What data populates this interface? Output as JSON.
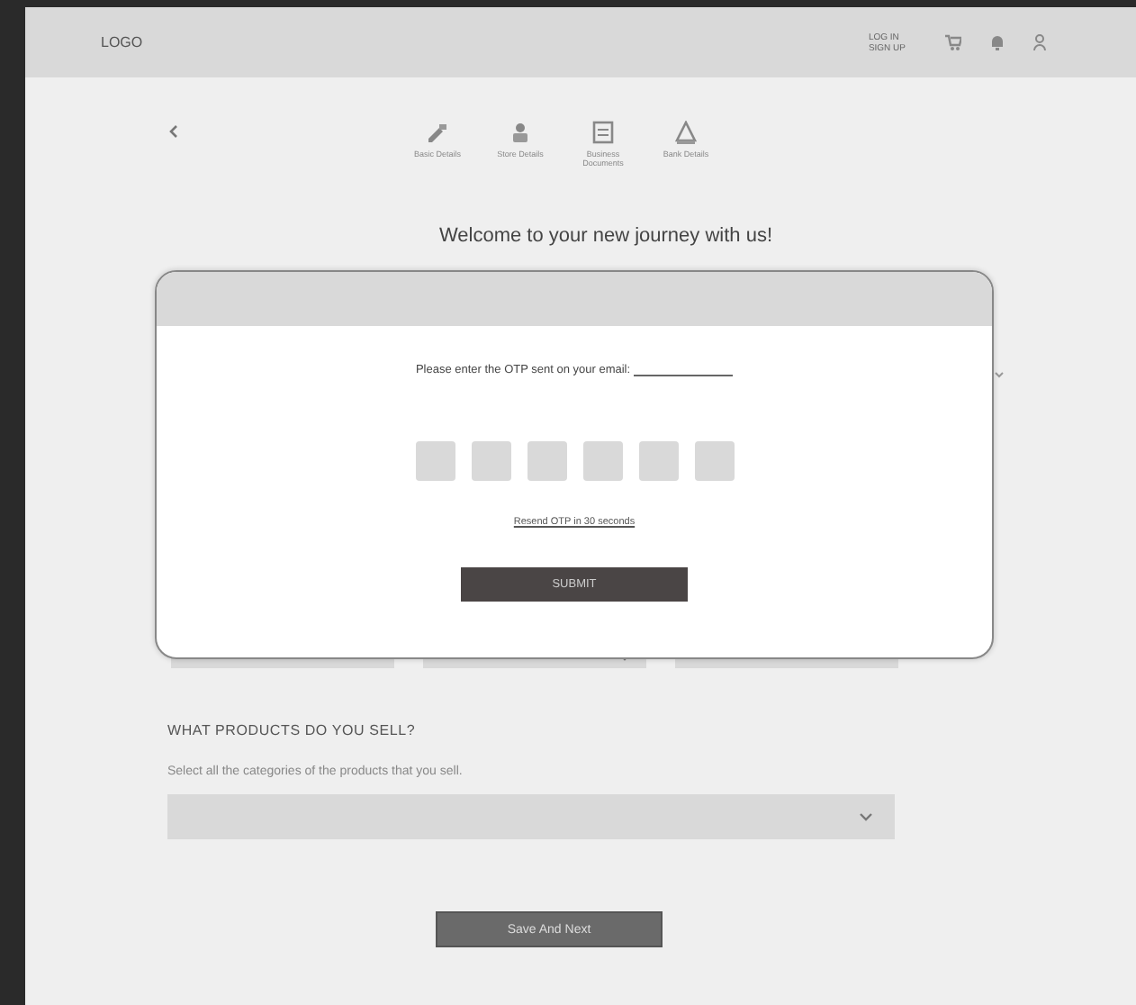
{
  "header": {
    "logo": "LOGO",
    "account_lines": [
      "LOG IN",
      "SIGN UP"
    ]
  },
  "steps": [
    {
      "label": "Basic Details"
    },
    {
      "label": "Store Details"
    },
    {
      "label": "Business Documents"
    },
    {
      "label": "Bank Details"
    }
  ],
  "title": "Welcome to your new journey with us!",
  "form_fields": [
    {
      "kind": "text"
    },
    {
      "kind": "dropdown"
    },
    {
      "kind": "text"
    }
  ],
  "products": {
    "heading": "WHAT PRODUCTS DO YOU SELL?",
    "hint": "Select all the categories of the products that you sell.",
    "dropdown": {
      "kind": "dropdown"
    }
  },
  "save_button": "Save And Next",
  "otp_modal": {
    "prompt": "Please enter the OTP sent on your email:",
    "digit_boxes": [
      {
        "kind": "box"
      },
      {
        "kind": "box"
      },
      {
        "kind": "box"
      },
      {
        "kind": "box"
      },
      {
        "kind": "box"
      },
      {
        "kind": "box"
      }
    ],
    "resend": "Resend OTP in 30 seconds",
    "submit": "SUBMIT"
  }
}
